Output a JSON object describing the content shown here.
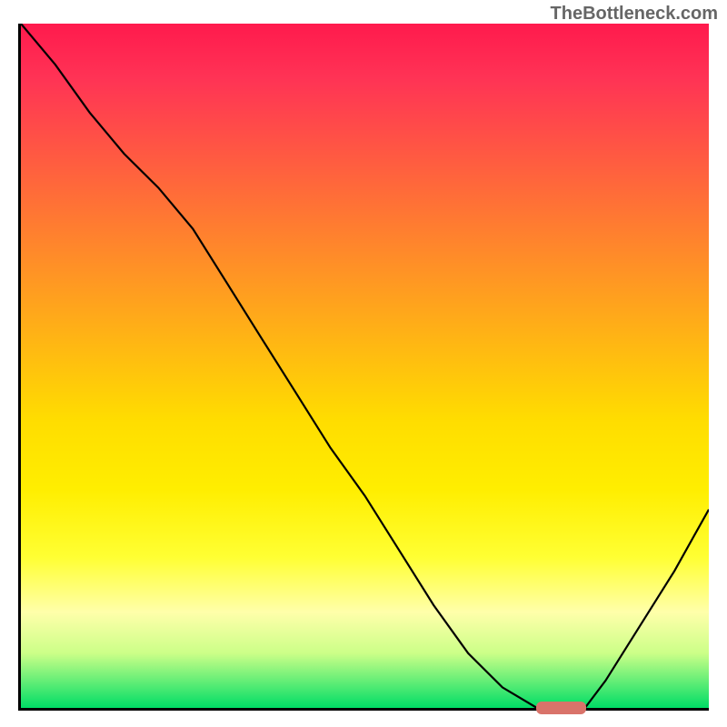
{
  "watermark": "TheBottleneck.com",
  "chart_data": {
    "type": "line",
    "title": "",
    "xlabel": "",
    "ylabel": "",
    "x": [
      0,
      5,
      10,
      15,
      20,
      25,
      30,
      35,
      40,
      45,
      50,
      55,
      60,
      65,
      70,
      75,
      80,
      82,
      85,
      90,
      95,
      100
    ],
    "values": [
      100,
      94,
      87,
      81,
      76,
      70,
      62,
      54,
      46,
      38,
      31,
      23,
      15,
      8,
      3,
      0,
      0,
      0,
      4,
      12,
      20,
      29
    ],
    "ylim": [
      0,
      100
    ],
    "xlim": [
      0,
      100
    ],
    "marker": {
      "x_start": 75,
      "x_end": 82,
      "y": 0
    },
    "background_gradient": {
      "top": "#ff1a4d",
      "mid": "#ffee00",
      "bottom": "#00dd66"
    }
  }
}
